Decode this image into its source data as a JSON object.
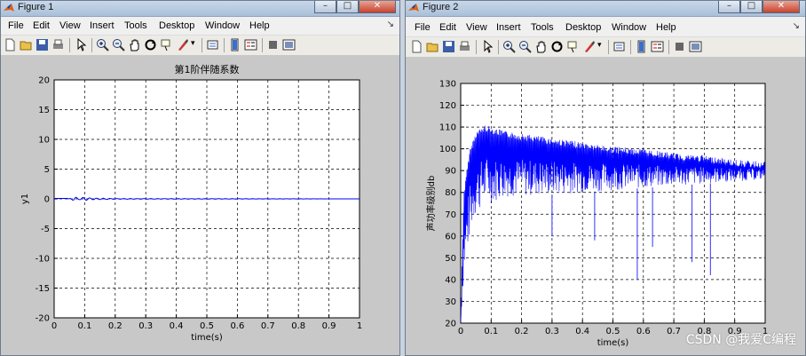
{
  "window1": {
    "title": "Figure 1",
    "menu": [
      "File",
      "Edit",
      "View",
      "Insert",
      "Tools",
      "Desktop",
      "Window",
      "Help"
    ],
    "chart_data": {
      "type": "line",
      "title": "第1阶伴随系数",
      "xlabel": "time(s)",
      "ylabel": "y1",
      "xlim": [
        0,
        1
      ],
      "ylim": [
        -20,
        20
      ],
      "xticks": [
        "0",
        "0.1",
        "0.2",
        "0.3",
        "0.4",
        "0.5",
        "0.6",
        "0.7",
        "0.8",
        "0.9",
        "1"
      ],
      "yticks": [
        "20",
        "15",
        "10",
        "5",
        "0",
        "-5",
        "-10",
        "-15",
        "-20"
      ],
      "grid": true,
      "series": [
        {
          "color": "#0000ff",
          "x": [
            0,
            0.02,
            0.04,
            0.05,
            0.06,
            0.07,
            0.08,
            0.09,
            0.1,
            0.11,
            0.12,
            0.14,
            0.16,
            0.2,
            0.3,
            0.5,
            0.7,
            1.0
          ],
          "y": [
            0,
            0.1,
            0.1,
            0.05,
            -0.2,
            -0.3,
            -0.1,
            0.2,
            0.25,
            -0.2,
            0.15,
            -0.12,
            0.1,
            -0.06,
            0.05,
            -0.03,
            0.02,
            0
          ]
        }
      ]
    }
  },
  "window2": {
    "title": "Figure 2",
    "menu": [
      "File",
      "Edit",
      "View",
      "Insert",
      "Tools",
      "Desktop",
      "Window",
      "Help"
    ],
    "chart_data": {
      "type": "line",
      "title": "",
      "xlabel": "time(s)",
      "ylabel": "声功率级别db",
      "xlim": [
        0,
        1
      ],
      "ylim": [
        20,
        130
      ],
      "xticks": [
        "0",
        "0.1",
        "0.2",
        "0.3",
        "0.4",
        "0.5",
        "0.6",
        "0.7",
        "0.8",
        "0.9",
        "1"
      ],
      "yticks": [
        "130",
        "120",
        "110",
        "100",
        "90",
        "80",
        "70",
        "60",
        "50",
        "40",
        "30",
        "20"
      ],
      "grid": true,
      "envelope": {
        "x": [
          0,
          0.01,
          0.03,
          0.05,
          0.08,
          0.1,
          0.15,
          0.2,
          0.3,
          0.4,
          0.5,
          0.6,
          0.7,
          0.8,
          0.9,
          1.0
        ],
        "upper": [
          20,
          80,
          100,
          108,
          111,
          110,
          108,
          107,
          105,
          103,
          101,
          100,
          98,
          97,
          95,
          94
        ],
        "lower": [
          20,
          40,
          60,
          70,
          75,
          75,
          78,
          78,
          79,
          80,
          81,
          82,
          83,
          84,
          85,
          86
        ]
      },
      "deep_dips": [
        {
          "x": 0.58,
          "y": 40
        },
        {
          "x": 0.76,
          "y": 48
        },
        {
          "x": 0.82,
          "y": 42
        },
        {
          "x": 0.3,
          "y": 60
        },
        {
          "x": 0.44,
          "y": 58
        },
        {
          "x": 0.63,
          "y": 55
        }
      ],
      "series": [
        {
          "color": "#0000ff"
        }
      ]
    }
  },
  "watermark": "CSDN @我爱C编程",
  "icons": [
    "new-file-icon",
    "open-folder-icon",
    "save-icon",
    "print-icon",
    "pointer-icon",
    "zoom-in-icon",
    "zoom-out-icon",
    "pan-icon",
    "rotate-icon",
    "data-cursor-icon",
    "brush-icon",
    "link-icon",
    "colorbar-icon",
    "legend-icon",
    "hide-plot-tools-icon",
    "show-plot-tools-icon"
  ]
}
